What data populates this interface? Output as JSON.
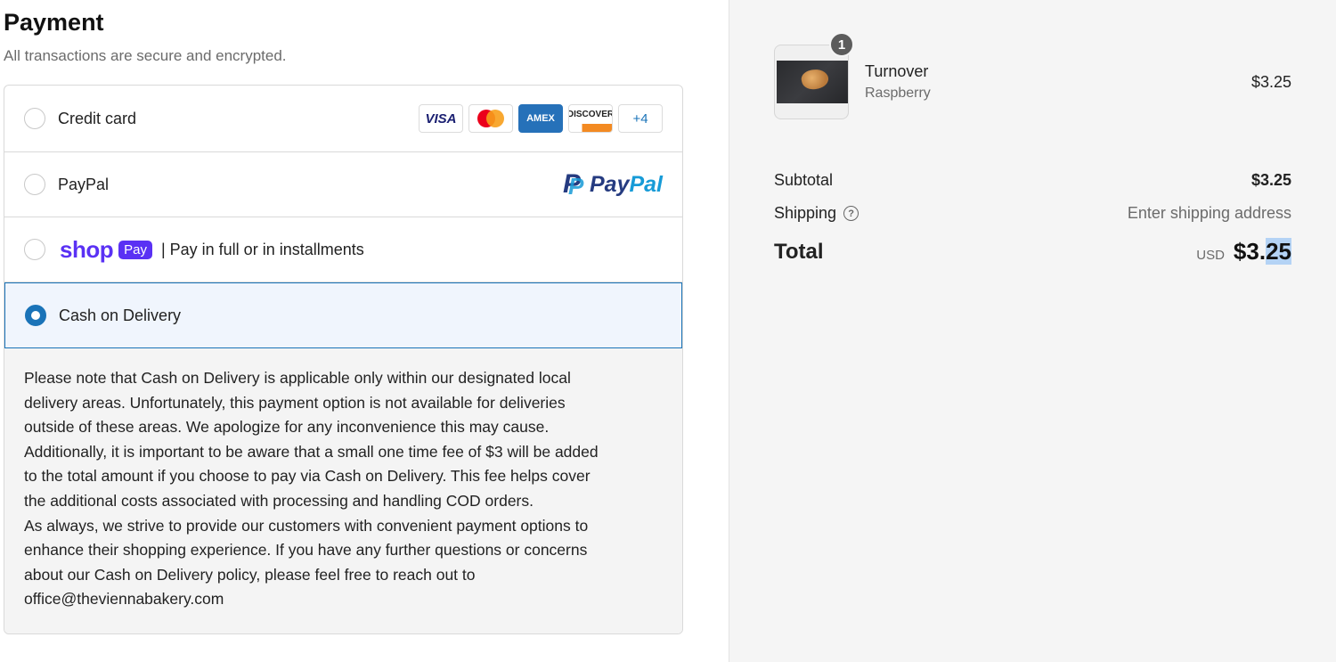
{
  "payment": {
    "title": "Payment",
    "subtitle": "All transactions are secure and encrypted.",
    "methods": [
      {
        "label": "Credit card",
        "selected": false
      },
      {
        "label": "PayPal",
        "selected": false
      },
      {
        "label": "| Pay in full or in installments",
        "selected": false
      },
      {
        "label": "Cash on Delivery",
        "selected": true
      }
    ],
    "card_logos": {
      "visa": "VISA",
      "amex": "AMEX",
      "discover": "DISCOVER",
      "more": "+4"
    },
    "paypal_logo": {
      "pay": "Pay",
      "pal": "Pal"
    },
    "shop_pay_logo": {
      "shop": "shop",
      "pay": "Pay"
    },
    "cod_note_lines": [
      "Please note that Cash on Delivery is applicable only within our designated local",
      "delivery areas. Unfortunately, this payment option is not available for deliveries",
      "outside of these areas. We apologize for any inconvenience this may cause.",
      "Additionally, it is important to be aware that a small one time fee of $3 will be added",
      "to the total amount if you choose to pay via Cash on Delivery. This fee helps cover",
      "the additional costs associated with processing and handling COD orders.",
      "As always, we strive to provide our customers with convenient payment options to",
      "enhance their shopping experience. If you have any further questions or concerns",
      "about our Cash on Delivery policy, please feel free to reach out to",
      "office@theviennabakery.com"
    ],
    "accent_color": "#1a73b8"
  },
  "summary": {
    "item": {
      "quantity": "1",
      "name": "Turnover",
      "variant": "Raspberry",
      "price": "$3.25"
    },
    "subtotal_label": "Subtotal",
    "subtotal_value": "$3.25",
    "shipping_label": "Shipping",
    "shipping_value": "Enter shipping address",
    "help_icon": "?",
    "total_label": "Total",
    "currency": "USD",
    "total_prefix": "$3.",
    "total_selected": "25"
  }
}
